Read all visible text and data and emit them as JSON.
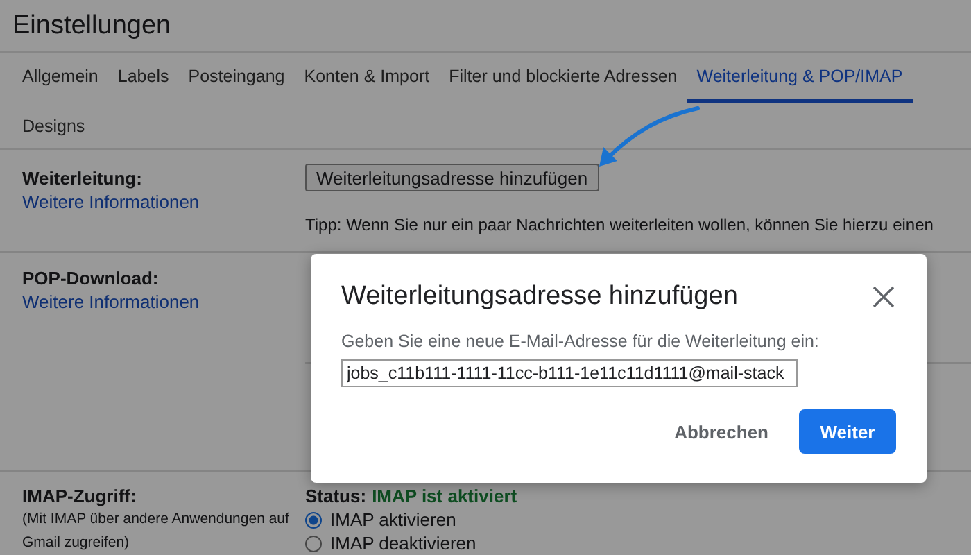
{
  "page_title": "Einstellungen",
  "tabs": [
    {
      "label": "Allgemein",
      "selected": false
    },
    {
      "label": "Labels",
      "selected": false
    },
    {
      "label": "Posteingang",
      "selected": false
    },
    {
      "label": "Konten & Import",
      "selected": false
    },
    {
      "label": "Filter und blockierte Adressen",
      "selected": false
    },
    {
      "label": "Weiterleitung & POP/IMAP",
      "selected": true
    },
    {
      "label": "Designs",
      "selected": false
    }
  ],
  "forwarding": {
    "label": "Weiterleitung:",
    "link": "Weitere Informationen",
    "button": "Weiterleitungsadresse hinzufügen",
    "tip": "Tipp: Wenn Sie nur ein paar Nachrichten weiterleiten wollen, können Sie hierzu einen"
  },
  "pop": {
    "label": "POP-Download:",
    "link": "Weitere Informationen"
  },
  "imap": {
    "label": "IMAP-Zugriff:",
    "note": [
      "(Mit IMAP über andere Anwendungen auf",
      "Gmail zugreifen)"
    ],
    "status_label": "Status:",
    "status_value": "IMAP ist aktiviert",
    "options": [
      {
        "label": "IMAP aktivieren",
        "selected": true
      },
      {
        "label": "IMAP deaktivieren",
        "selected": false
      }
    ]
  },
  "dialog": {
    "title": "Weiterleitungsadresse hinzufügen",
    "prompt": "Geben Sie eine neue E-Mail-Adresse für die Weiterleitung ein:",
    "value": "jobs_c11b111-1111-11cc-b111-1e11c11d1111@mail-stack",
    "cancel": "Abbrechen",
    "confirm": "Weiter"
  }
}
